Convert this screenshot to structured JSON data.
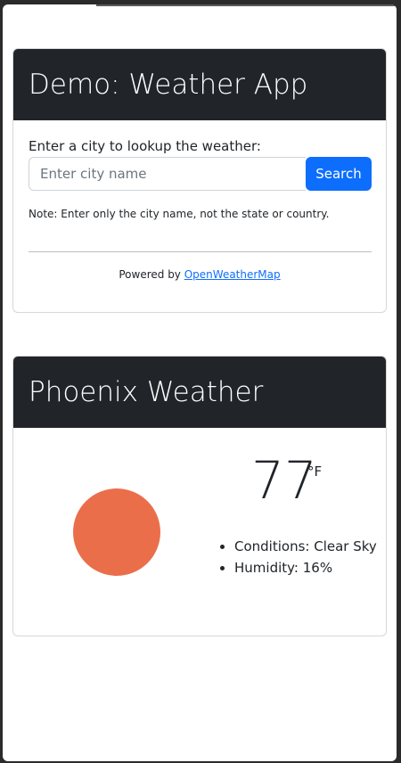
{
  "lookup_card": {
    "title": "Demo: Weather App",
    "label": "Enter a city to lookup the weather:",
    "input_placeholder": "Enter city name",
    "input_value": "",
    "search_label": "Search",
    "note": "Note: Enter only the city name, not the state or country.",
    "powered_prefix": "Powered by ",
    "powered_link": "OpenWeatherMap"
  },
  "weather_card": {
    "title": "Phoenix Weather",
    "icon": "sun-icon",
    "temperature": "77",
    "unit": "°F",
    "details": [
      "Conditions: Clear Sky",
      "Humidity: 16%"
    ]
  },
  "colors": {
    "header_bg": "#212529",
    "button_bg": "#0d6efd",
    "sun": "#eb6e4b"
  }
}
